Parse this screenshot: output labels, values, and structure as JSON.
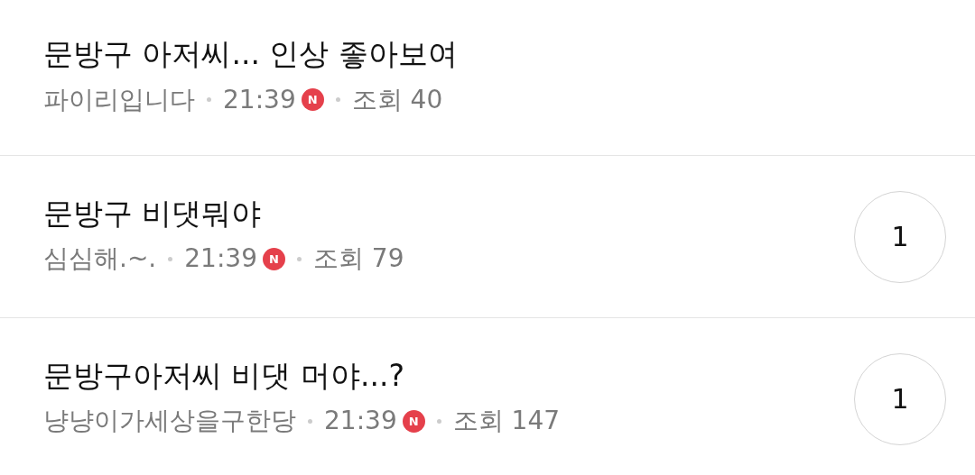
{
  "posts": [
    {
      "title": "문방구 아저씨... 인상 좋아보여",
      "author": "파이리입니다",
      "time": "21:39",
      "new_badge": "N",
      "views": "조회 40"
    },
    {
      "title": "문방구 비댓뭐야",
      "author": "심심해.~.",
      "time": "21:39",
      "new_badge": "N",
      "views": "조회 79",
      "comments": "1"
    },
    {
      "title": "문방구아저씨 비댓 머야...?",
      "author": "냥냥이가세상을구한당",
      "time": "21:39",
      "new_badge": "N",
      "views": "조회 147",
      "comments": "1"
    }
  ]
}
